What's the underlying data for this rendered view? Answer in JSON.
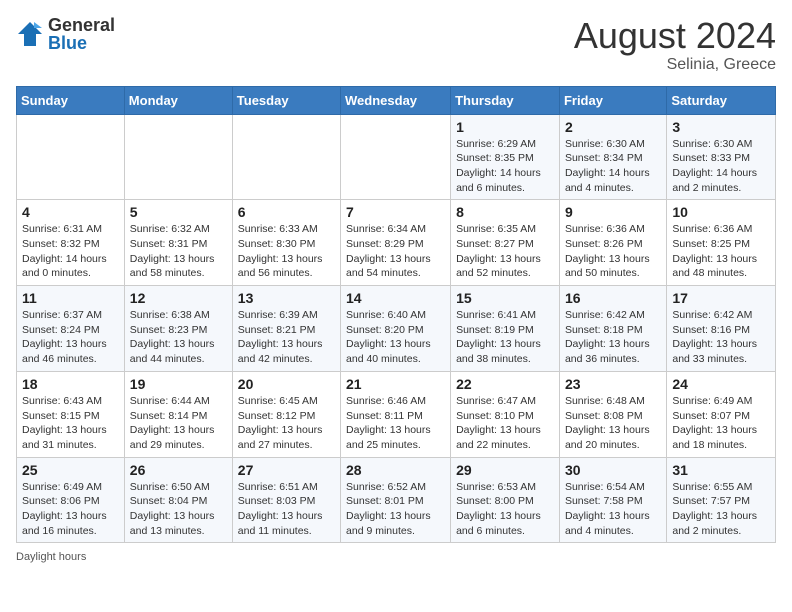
{
  "header": {
    "logo_general": "General",
    "logo_blue": "Blue",
    "month_year": "August 2024",
    "location": "Selinia, Greece"
  },
  "days_of_week": [
    "Sunday",
    "Monday",
    "Tuesday",
    "Wednesday",
    "Thursday",
    "Friday",
    "Saturday"
  ],
  "footer": {
    "daylight_label": "Daylight hours"
  },
  "weeks": [
    [
      {
        "day": "",
        "info": ""
      },
      {
        "day": "",
        "info": ""
      },
      {
        "day": "",
        "info": ""
      },
      {
        "day": "",
        "info": ""
      },
      {
        "day": "1",
        "info": "Sunrise: 6:29 AM\nSunset: 8:35 PM\nDaylight: 14 hours and 6 minutes."
      },
      {
        "day": "2",
        "info": "Sunrise: 6:30 AM\nSunset: 8:34 PM\nDaylight: 14 hours and 4 minutes."
      },
      {
        "day": "3",
        "info": "Sunrise: 6:30 AM\nSunset: 8:33 PM\nDaylight: 14 hours and 2 minutes."
      }
    ],
    [
      {
        "day": "4",
        "info": "Sunrise: 6:31 AM\nSunset: 8:32 PM\nDaylight: 14 hours and 0 minutes."
      },
      {
        "day": "5",
        "info": "Sunrise: 6:32 AM\nSunset: 8:31 PM\nDaylight: 13 hours and 58 minutes."
      },
      {
        "day": "6",
        "info": "Sunrise: 6:33 AM\nSunset: 8:30 PM\nDaylight: 13 hours and 56 minutes."
      },
      {
        "day": "7",
        "info": "Sunrise: 6:34 AM\nSunset: 8:29 PM\nDaylight: 13 hours and 54 minutes."
      },
      {
        "day": "8",
        "info": "Sunrise: 6:35 AM\nSunset: 8:27 PM\nDaylight: 13 hours and 52 minutes."
      },
      {
        "day": "9",
        "info": "Sunrise: 6:36 AM\nSunset: 8:26 PM\nDaylight: 13 hours and 50 minutes."
      },
      {
        "day": "10",
        "info": "Sunrise: 6:36 AM\nSunset: 8:25 PM\nDaylight: 13 hours and 48 minutes."
      }
    ],
    [
      {
        "day": "11",
        "info": "Sunrise: 6:37 AM\nSunset: 8:24 PM\nDaylight: 13 hours and 46 minutes."
      },
      {
        "day": "12",
        "info": "Sunrise: 6:38 AM\nSunset: 8:23 PM\nDaylight: 13 hours and 44 minutes."
      },
      {
        "day": "13",
        "info": "Sunrise: 6:39 AM\nSunset: 8:21 PM\nDaylight: 13 hours and 42 minutes."
      },
      {
        "day": "14",
        "info": "Sunrise: 6:40 AM\nSunset: 8:20 PM\nDaylight: 13 hours and 40 minutes."
      },
      {
        "day": "15",
        "info": "Sunrise: 6:41 AM\nSunset: 8:19 PM\nDaylight: 13 hours and 38 minutes."
      },
      {
        "day": "16",
        "info": "Sunrise: 6:42 AM\nSunset: 8:18 PM\nDaylight: 13 hours and 36 minutes."
      },
      {
        "day": "17",
        "info": "Sunrise: 6:42 AM\nSunset: 8:16 PM\nDaylight: 13 hours and 33 minutes."
      }
    ],
    [
      {
        "day": "18",
        "info": "Sunrise: 6:43 AM\nSunset: 8:15 PM\nDaylight: 13 hours and 31 minutes."
      },
      {
        "day": "19",
        "info": "Sunrise: 6:44 AM\nSunset: 8:14 PM\nDaylight: 13 hours and 29 minutes."
      },
      {
        "day": "20",
        "info": "Sunrise: 6:45 AM\nSunset: 8:12 PM\nDaylight: 13 hours and 27 minutes."
      },
      {
        "day": "21",
        "info": "Sunrise: 6:46 AM\nSunset: 8:11 PM\nDaylight: 13 hours and 25 minutes."
      },
      {
        "day": "22",
        "info": "Sunrise: 6:47 AM\nSunset: 8:10 PM\nDaylight: 13 hours and 22 minutes."
      },
      {
        "day": "23",
        "info": "Sunrise: 6:48 AM\nSunset: 8:08 PM\nDaylight: 13 hours and 20 minutes."
      },
      {
        "day": "24",
        "info": "Sunrise: 6:49 AM\nSunset: 8:07 PM\nDaylight: 13 hours and 18 minutes."
      }
    ],
    [
      {
        "day": "25",
        "info": "Sunrise: 6:49 AM\nSunset: 8:06 PM\nDaylight: 13 hours and 16 minutes."
      },
      {
        "day": "26",
        "info": "Sunrise: 6:50 AM\nSunset: 8:04 PM\nDaylight: 13 hours and 13 minutes."
      },
      {
        "day": "27",
        "info": "Sunrise: 6:51 AM\nSunset: 8:03 PM\nDaylight: 13 hours and 11 minutes."
      },
      {
        "day": "28",
        "info": "Sunrise: 6:52 AM\nSunset: 8:01 PM\nDaylight: 13 hours and 9 minutes."
      },
      {
        "day": "29",
        "info": "Sunrise: 6:53 AM\nSunset: 8:00 PM\nDaylight: 13 hours and 6 minutes."
      },
      {
        "day": "30",
        "info": "Sunrise: 6:54 AM\nSunset: 7:58 PM\nDaylight: 13 hours and 4 minutes."
      },
      {
        "day": "31",
        "info": "Sunrise: 6:55 AM\nSunset: 7:57 PM\nDaylight: 13 hours and 2 minutes."
      }
    ]
  ]
}
